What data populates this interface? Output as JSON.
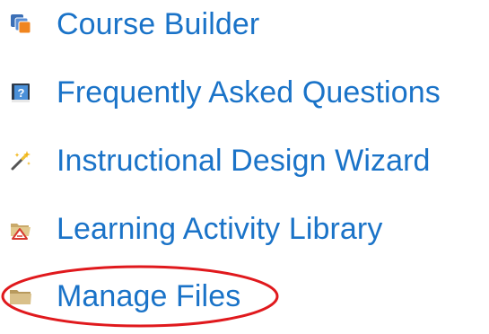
{
  "menu": {
    "items": [
      {
        "label": "Course Builder",
        "icon": "course-builder-icon"
      },
      {
        "label": "Frequently Asked Questions",
        "icon": "faq-book-icon"
      },
      {
        "label": "Instructional Design Wizard",
        "icon": "magic-wand-icon"
      },
      {
        "label": "Learning Activity Library",
        "icon": "activity-library-icon"
      },
      {
        "label": "Manage Files",
        "icon": "folder-icon"
      }
    ]
  },
  "colors": {
    "link": "#1a73c8",
    "highlight_circle": "#e0191d"
  }
}
